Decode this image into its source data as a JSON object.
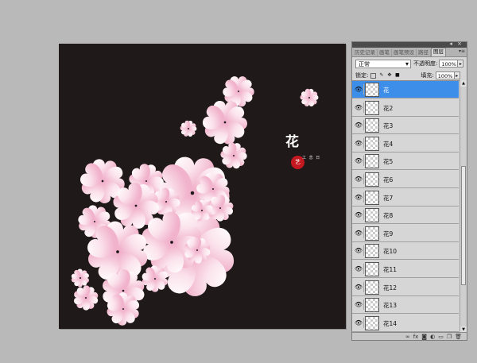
{
  "canvas": {
    "title_char": "花",
    "seal_text": "艺",
    "small_script": "工 念 日"
  },
  "panel": {
    "tabs": [
      "历史记录",
      "画笔",
      "画笔预设",
      "路径",
      "图层"
    ],
    "active_tab": "图层",
    "menu_icon": "panel-menu-icon",
    "blend_mode": "正常",
    "opacity_label": "不透明度:",
    "opacity_value": "100%",
    "lock_label": "锁定:",
    "fill_label": "填充:",
    "fill_value": "100%",
    "layers": [
      {
        "name": "花",
        "selected": true
      },
      {
        "name": "花2"
      },
      {
        "name": "花3"
      },
      {
        "name": "花4"
      },
      {
        "name": "花5"
      },
      {
        "name": "花6"
      },
      {
        "name": "花7"
      },
      {
        "name": "花8"
      },
      {
        "name": "花9"
      },
      {
        "name": "花10"
      },
      {
        "name": "花11"
      },
      {
        "name": "花12"
      },
      {
        "name": "花13"
      },
      {
        "name": "花14"
      }
    ],
    "bottom_icons": [
      "link-icon",
      "fx-icon",
      "mask-icon",
      "adjustment-icon",
      "group-icon",
      "new-layer-icon",
      "trash-icon"
    ],
    "colors": {
      "selected_row": "#3d8ee8",
      "canvas_bg": "#201919",
      "petal_pink": "#f3b9cf",
      "seal_red": "#c41820"
    }
  }
}
